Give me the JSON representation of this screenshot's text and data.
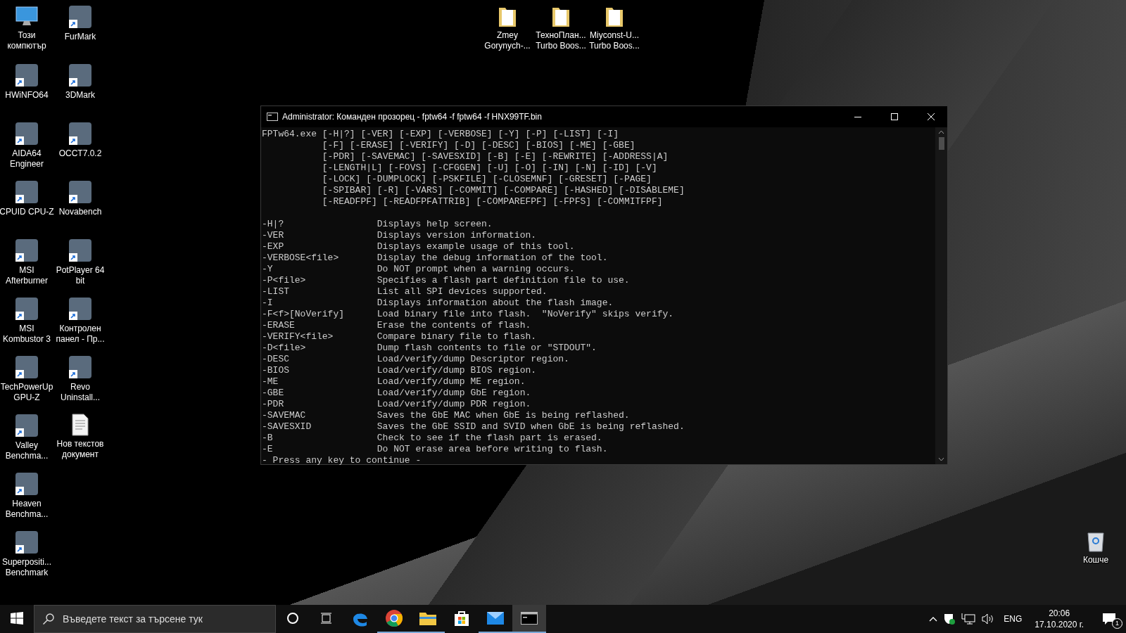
{
  "desktop_columns": [
    {
      "icons": [
        {
          "label": "Този\nкомпютър",
          "kind": "computer"
        },
        {
          "label": "HWiNFO64",
          "kind": "app"
        },
        {
          "label": "AIDA64\nEngineer",
          "kind": "app"
        },
        {
          "label": "CPUID CPU-Z",
          "kind": "app"
        },
        {
          "label": "MSI\nAfterburner",
          "kind": "app"
        },
        {
          "label": "MSI\nKombustor 3",
          "kind": "app"
        },
        {
          "label": "TechPowerUp\nGPU-Z",
          "kind": "app"
        },
        {
          "label": "Valley\nBenchma...",
          "kind": "app"
        },
        {
          "label": "Heaven\nBenchma...",
          "kind": "app"
        },
        {
          "label": "Superpositi...\nBenchmark",
          "kind": "app"
        }
      ]
    },
    {
      "icons": [
        {
          "label": "FurMark",
          "kind": "app"
        },
        {
          "label": "3DMark",
          "kind": "app"
        },
        {
          "label": "OCCT7.0.2",
          "kind": "app"
        },
        {
          "label": "Novabench",
          "kind": "app"
        },
        {
          "label": "PotPlayer 64\nbit",
          "kind": "app"
        },
        {
          "label": "Контролен\nпанел - Пр...",
          "kind": "app"
        },
        {
          "label": "Revo\nUninstall...",
          "kind": "app"
        },
        {
          "label": "Нов текстов\nдокумент",
          "kind": "document"
        }
      ]
    }
  ],
  "top_icons": [
    {
      "label": "Zmey\nGorynych-..."
    },
    {
      "label": "ТехноПлан...\nTurbo Boos..."
    },
    {
      "label": "Miyconst-U...\nTurbo Boos..."
    }
  ],
  "recycle_bin": {
    "label": "Кошче"
  },
  "console": {
    "title": "Administrator: Команден прозорец - fptw64  -f fptw64 -f HNX99TF.bin",
    "program": "FPTw64.exe",
    "usage": [
      "[-H|?] [-VER] [-EXP] [-VERBOSE] [-Y] [-P] [-LIST] [-I]",
      "[-F] [-ERASE] [-VERIFY] [-D] [-DESC] [-BIOS] [-ME] [-GBE]",
      "[-PDR] [-SAVEMAC] [-SAVESXID] [-B] [-E] [-REWRITE] [-ADDRESS|A]",
      "[-LENGTH|L] [-FOVS] [-CFGGEN] [-U] [-O] [-IN] [-N] [-ID] [-V]",
      "[-LOCK] [-DUMPLOCK] [-PSKFILE] [-CLOSEMNF] [-GRESET] [-PAGE]",
      "[-SPIBAR] [-R] [-VARS] [-COMMIT] [-COMPARE] [-HASHED] [-DISABLEME]",
      "[-READFPF] [-READFPFATTRIB] [-COMPAREFPF] [-FPFS] [-COMMITFPF]"
    ],
    "options": [
      {
        "flag": "-H|?",
        "description": "Displays help screen."
      },
      {
        "flag": "-VER",
        "description": "Displays version information."
      },
      {
        "flag": "-EXP",
        "description": "Displays example usage of this tool."
      },
      {
        "flag": "-VERBOSE<file>",
        "description": "Display the debug information of the tool."
      },
      {
        "flag": "-Y",
        "description": "Do NOT prompt when a warning occurs."
      },
      {
        "flag": "-P<file>",
        "description": "Specifies a flash part definition file to use."
      },
      {
        "flag": "-LIST",
        "description": "List all SPI devices supported."
      },
      {
        "flag": "-I",
        "description": "Displays information about the flash image."
      },
      {
        "flag": "-F<f>[NoVerify]",
        "description": "Load binary file into flash.  \"NoVerify\" skips verify."
      },
      {
        "flag": "-ERASE",
        "description": "Erase the contents of flash."
      },
      {
        "flag": "-VERIFY<file>",
        "description": "Compare binary file to flash."
      },
      {
        "flag": "-D<file>",
        "description": "Dump flash contents to file or \"STDOUT\"."
      },
      {
        "flag": "-DESC",
        "description": "Load/verify/dump Descriptor region."
      },
      {
        "flag": "-BIOS",
        "description": "Load/verify/dump BIOS region."
      },
      {
        "flag": "-ME",
        "description": "Load/verify/dump ME region."
      },
      {
        "flag": "-GBE",
        "description": "Load/verify/dump GbE region."
      },
      {
        "flag": "-PDR",
        "description": "Load/verify/dump PDR region."
      },
      {
        "flag": "-SAVEMAC",
        "description": "Saves the GbE MAC when GbE is being reflashed."
      },
      {
        "flag": "-SAVESXID",
        "description": "Saves the GbE SSID and SVID when GbE is being reflashed."
      },
      {
        "flag": "-B",
        "description": "Check to see if the flash part is erased."
      },
      {
        "flag": "-E",
        "description": "Do NOT erase area before writing to flash."
      }
    ],
    "prompt": "- Press any key to continue -"
  },
  "taskbar": {
    "search": {
      "placeholder": "Въведете текст за търсене тук"
    },
    "apps": [
      {
        "kind": "edge",
        "running": false,
        "selected": false
      },
      {
        "kind": "chrome",
        "running": true,
        "selected": false
      },
      {
        "kind": "explorer",
        "running": true,
        "selected": false
      },
      {
        "kind": "store",
        "running": false,
        "selected": false
      },
      {
        "kind": "mail",
        "running": true,
        "selected": false
      },
      {
        "kind": "console",
        "running": true,
        "selected": true
      }
    ],
    "language": "ENG",
    "time": "20:06",
    "date": "17.10.2020 г.",
    "notifications": "1"
  }
}
